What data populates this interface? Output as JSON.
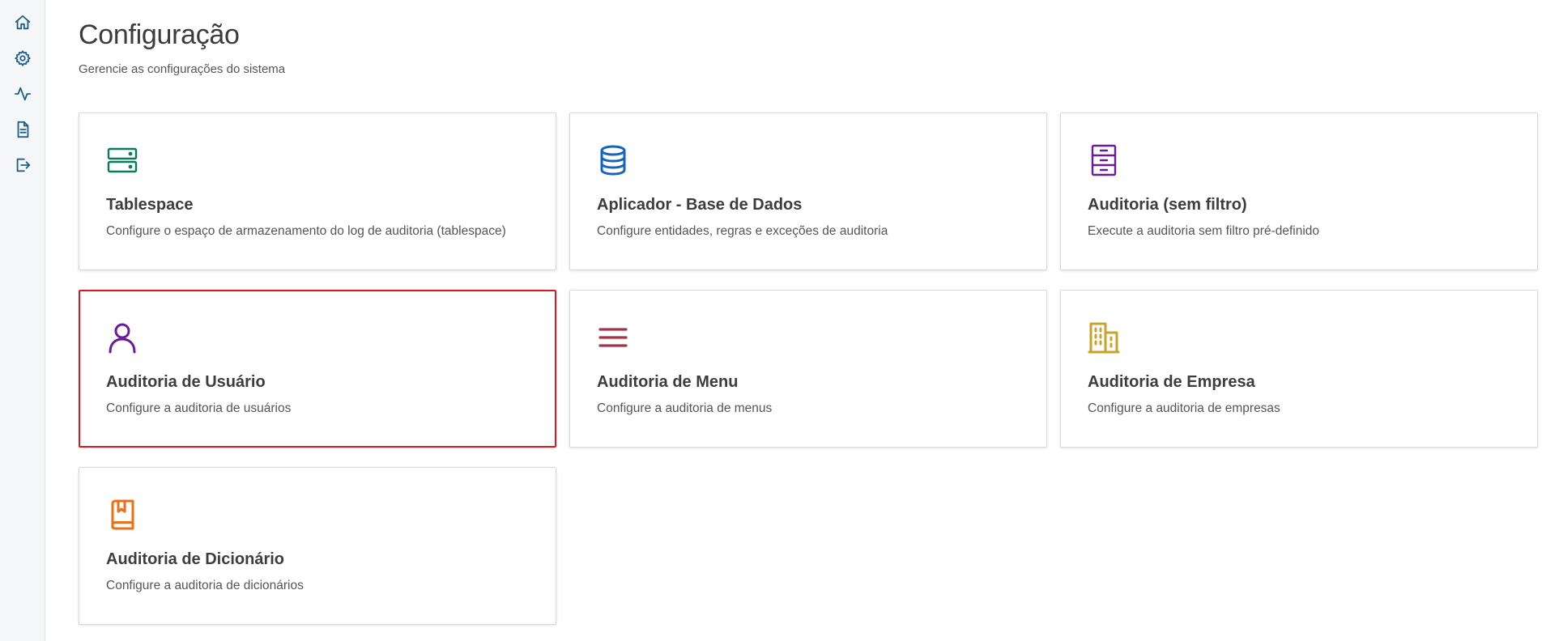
{
  "sidebar": {
    "items": [
      {
        "name": "home",
        "icon": "home-icon"
      },
      {
        "name": "settings",
        "icon": "gear-icon"
      },
      {
        "name": "activity",
        "icon": "activity-icon"
      },
      {
        "name": "document",
        "icon": "document-icon"
      },
      {
        "name": "logout",
        "icon": "logout-icon"
      }
    ]
  },
  "header": {
    "title": "Configuração",
    "subtitle": "Gerencie as configurações do sistema"
  },
  "cards": [
    {
      "title": "Tablespace",
      "description": "Configure o espaço de armazenamento do log de auditoria (tablespace)",
      "icon": "server-icon",
      "color": "#0e7a5c"
    },
    {
      "title": "Aplicador - Base de Dados",
      "description": "Configure entidades, regras e exceções de auditoria",
      "icon": "database-icon",
      "color": "#1565c0"
    },
    {
      "title": "Auditoria (sem filtro)",
      "description": "Execute a auditoria sem filtro pré-definido",
      "icon": "archive-icon",
      "color": "#6a1b9a"
    },
    {
      "title": "Auditoria de Usuário",
      "description": "Configure a auditoria de usuários",
      "icon": "user-icon",
      "color": "#6a1b9a",
      "selected": true
    },
    {
      "title": "Auditoria de Menu",
      "description": "Configure a auditoria de menus",
      "icon": "menu-icon",
      "color": "#a83246"
    },
    {
      "title": "Auditoria de Empresa",
      "description": "Configure a auditoria de empresas",
      "icon": "building-icon",
      "color": "#c9a227"
    },
    {
      "title": "Auditoria de Dicionário",
      "description": "Configure a auditoria de dicionários",
      "icon": "book-icon",
      "color": "#e8701a"
    }
  ],
  "colors": {
    "sidebar_icon": "#1f5f8b",
    "selected_border": "#e3141c"
  }
}
